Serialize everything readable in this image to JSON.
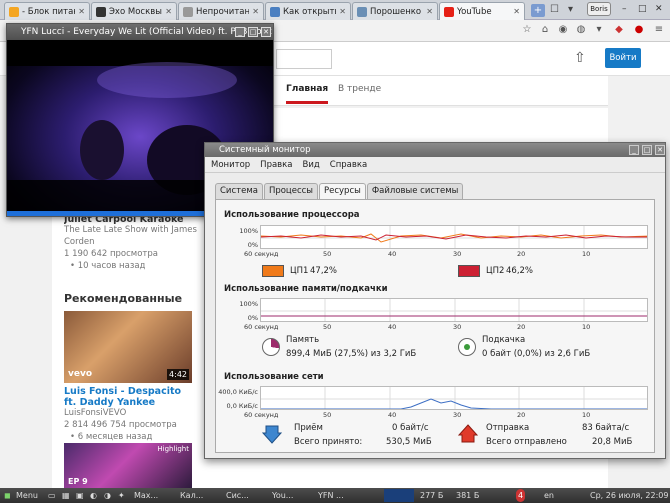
{
  "browser": {
    "tabs": [
      {
        "label": "- Блок питан",
        "fav_color": "#f4a623"
      },
      {
        "label": "Эхо Москвы:",
        "fav_color": "#333333"
      },
      {
        "label": "Непрочитан",
        "fav_color": "#999999"
      },
      {
        "label": "Как открыть",
        "fav_color": "#4a7fc1"
      },
      {
        "label": "Порошенко",
        "fav_color": "#6a8fb5"
      },
      {
        "label": "YouTube",
        "fav_color": "#e62117"
      }
    ],
    "user": "Boris"
  },
  "youtube": {
    "login_label": "Войти",
    "nav_tabs": [
      "Главная",
      "В тренде"
    ],
    "first_video": {
      "title_partial": "Juliet Carpool Karaoke",
      "channel": "The Late Late Show with James Corden",
      "views": "1 190 642 просмотра",
      "ago": "• 10 часов назад"
    },
    "section_title": "Рекомендованные",
    "rec_video": {
      "title": "Luis Fonsi - Despacito ft. Daddy Yankee",
      "channel": "LuisFonsiVEVO",
      "views": "2 814 496 754 просмотра",
      "ago": "• 6 месяцев назад",
      "duration": "4:42",
      "badge": "vevo"
    },
    "second_thumb": {
      "label": "EP 9",
      "tag": "Highlight"
    }
  },
  "player": {
    "title": "YFN Lucci - Everyday We Lit (Official Video) ft. PnB Rock",
    "progress": 0.9
  },
  "sysmon": {
    "title": "Системный монитор",
    "menu": [
      "Монитор",
      "Правка",
      "Вид",
      "Справка"
    ],
    "tabs": [
      "Система",
      "Процессы",
      "Ресурсы",
      "Файловые системы"
    ],
    "active_tab": "Ресурсы",
    "cpu": {
      "title": "Использование процессора",
      "y_ticks": [
        "100%",
        "0%"
      ],
      "x_ticks": [
        "60 секунд",
        "50",
        "40",
        "30",
        "20",
        "10"
      ],
      "cpu1_label": "ЦП1",
      "cpu1_value": "47,2%",
      "cpu1_color": "#f07a1a",
      "cpu2_label": "ЦП2",
      "cpu2_value": "46,2%",
      "cpu2_color": "#cc2033"
    },
    "memory": {
      "title": "Использование памяти/подкачки",
      "y_ticks": [
        "100%",
        "0%"
      ],
      "x_ticks": [
        "60 секунд",
        "50",
        "40",
        "30",
        "20",
        "10"
      ],
      "mem_label": "Память",
      "mem_value": "899,4 МиБ (27,5%) из 3,2 ГиБ",
      "swap_label": "Подкачка",
      "swap_value": "0 байт (0,0%) из 2,6 ГиБ"
    },
    "network": {
      "title": "Использование сети",
      "y_ticks": [
        "400,0 КиБ/с",
        "0,0 КиБ/с"
      ],
      "x_ticks": [
        "60 секунд",
        "50",
        "40",
        "30",
        "20",
        "10"
      ],
      "recv_label": "Приём",
      "recv_rate": "0 байт/с",
      "recv_total_label": "Всего принято:",
      "recv_total": "530,5 МиБ",
      "send_label": "Отправка",
      "send_rate": "83 байта/с",
      "send_total_label": "Всего отправлено",
      "send_total": "20,8 МиБ"
    }
  },
  "taskbar": {
    "menu_label": "Menu",
    "apps": [
      "Max...",
      "Кал...",
      "Сис...",
      "You...",
      "YFN ..."
    ],
    "tray": [
      "277 Б",
      "381 Б"
    ],
    "notify_count": "4",
    "lang": "en",
    "clock": "Ср, 26 июля, 22:09"
  }
}
